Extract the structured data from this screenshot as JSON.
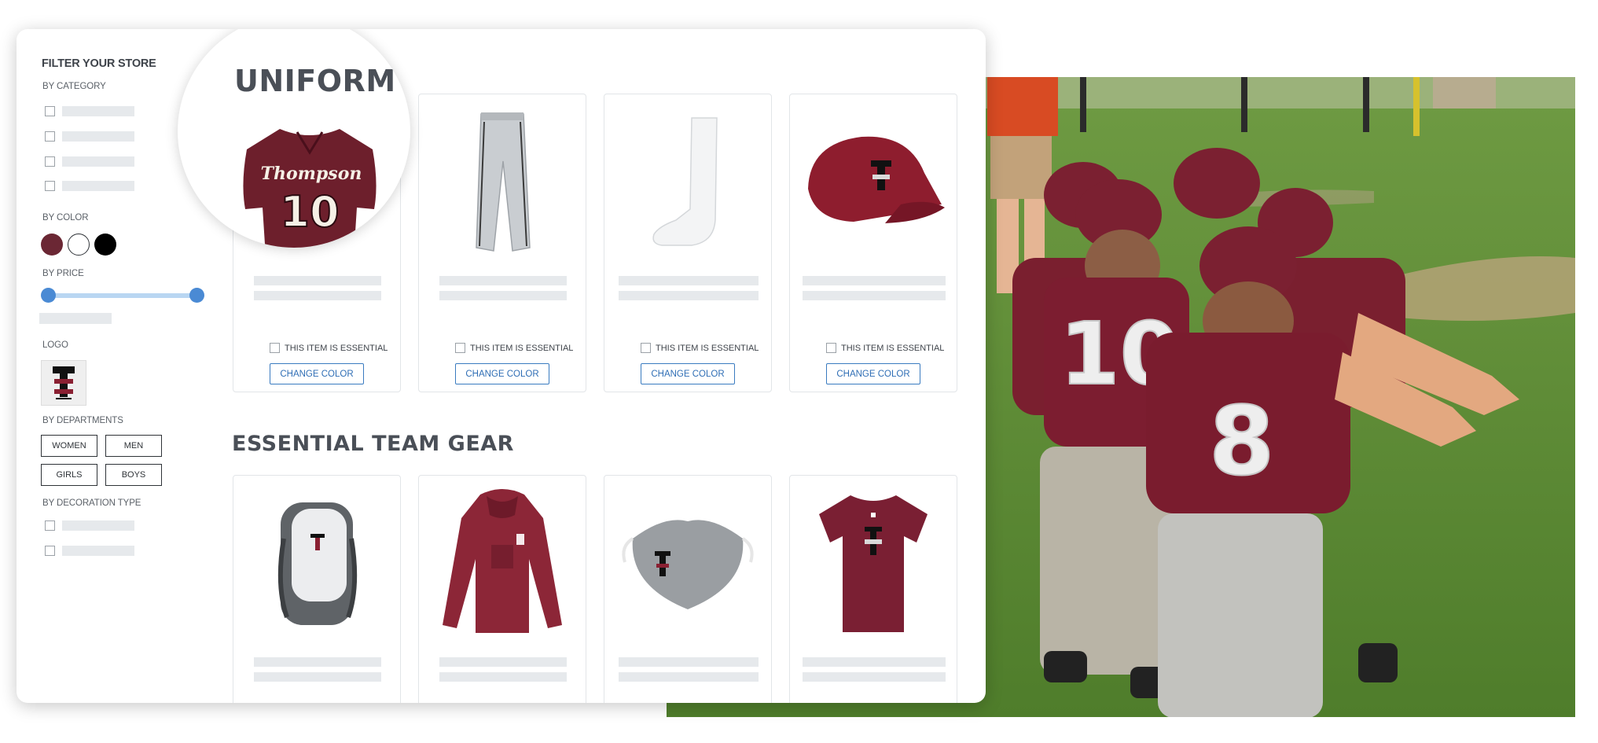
{
  "sidebar": {
    "title": "FILTER YOUR STORE",
    "by_category": "BY CATEGORY",
    "by_color": "BY COLOR",
    "colors": [
      "#6b2734",
      "#ffffff",
      "#000000"
    ],
    "by_price": "BY PRICE",
    "logo": "LOGO",
    "by_departments": "BY DEPARTMENTS",
    "departments": [
      "WOMEN",
      "MEN",
      "GIRLS",
      "BOYS"
    ],
    "by_decoration": "BY DECORATION TYPE"
  },
  "uniform": {
    "heading": "UNIFORM",
    "jersey_name": "Thompson",
    "jersey_number": "10",
    "essential_label": "THIS ITEM IS ESSENTIAL",
    "change_color": "CHANGE COLOR"
  },
  "team_gear": {
    "heading": "ESSENTIAL TEAM GEAR"
  },
  "photo": {
    "back_numbers": [
      "10",
      "8"
    ]
  },
  "brand": {
    "maroon": "#6b2734",
    "accent_blue": "#3a7bc0",
    "slider_blue": "#4a8ad4"
  }
}
